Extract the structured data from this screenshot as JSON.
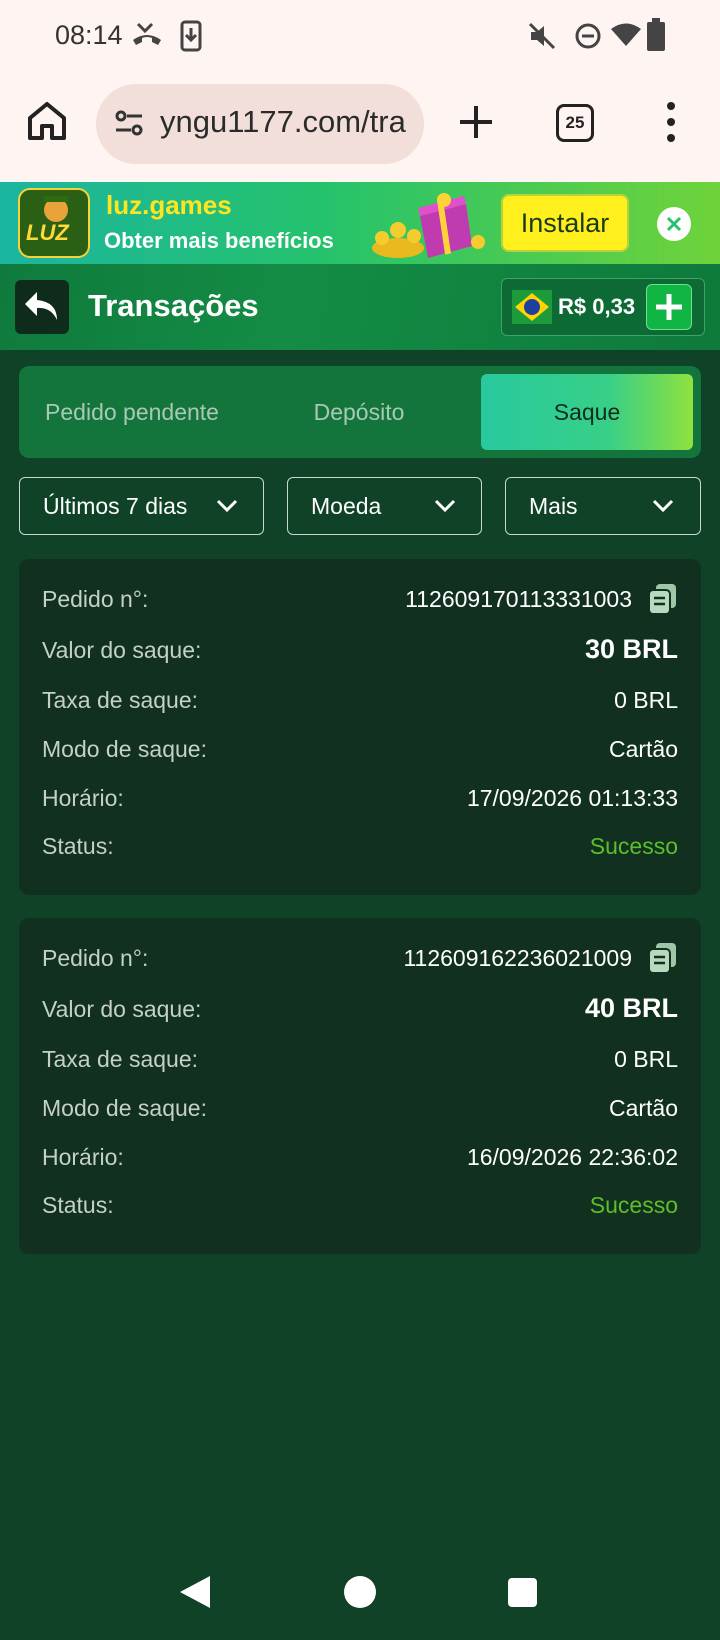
{
  "status_bar": {
    "time": "08:14"
  },
  "browser": {
    "url": "yngu1177.com/tra",
    "tab_count": "25"
  },
  "banner": {
    "logo_text": "LUZ",
    "title": "luz.games",
    "subtitle": "Obter mais benefícios",
    "install_label": "Instalar"
  },
  "header": {
    "title": "Transações",
    "balance": "R$ 0,33"
  },
  "tabs": [
    {
      "label": "Pedido pendente",
      "active": false
    },
    {
      "label": "Depósito",
      "active": false
    },
    {
      "label": "Saque",
      "active": true
    }
  ],
  "filters": {
    "period": "Últimos 7 dias",
    "currency": "Moeda",
    "more": "Mais"
  },
  "labels": {
    "order_no": "Pedido n°:",
    "amount": "Valor do saque:",
    "fee": "Taxa de saque:",
    "mode": "Modo de saque:",
    "time": "Horário:",
    "status": "Status:"
  },
  "transactions": [
    {
      "order_no": "112609170113331003",
      "amount": "30 BRL",
      "fee": "0 BRL",
      "mode": "Cartão",
      "time": "17/09/2026 01:13:33",
      "status": "Sucesso"
    },
    {
      "order_no": "112609162236021009",
      "amount": "40 BRL",
      "fee": "0 BRL",
      "mode": "Cartão",
      "time": "16/09/2026 22:36:02",
      "status": "Sucesso"
    }
  ],
  "colors": {
    "page_bg": "#0f4227",
    "card_bg": "#11301f",
    "success": "#5cbf2a",
    "accent": "#38cf88"
  }
}
